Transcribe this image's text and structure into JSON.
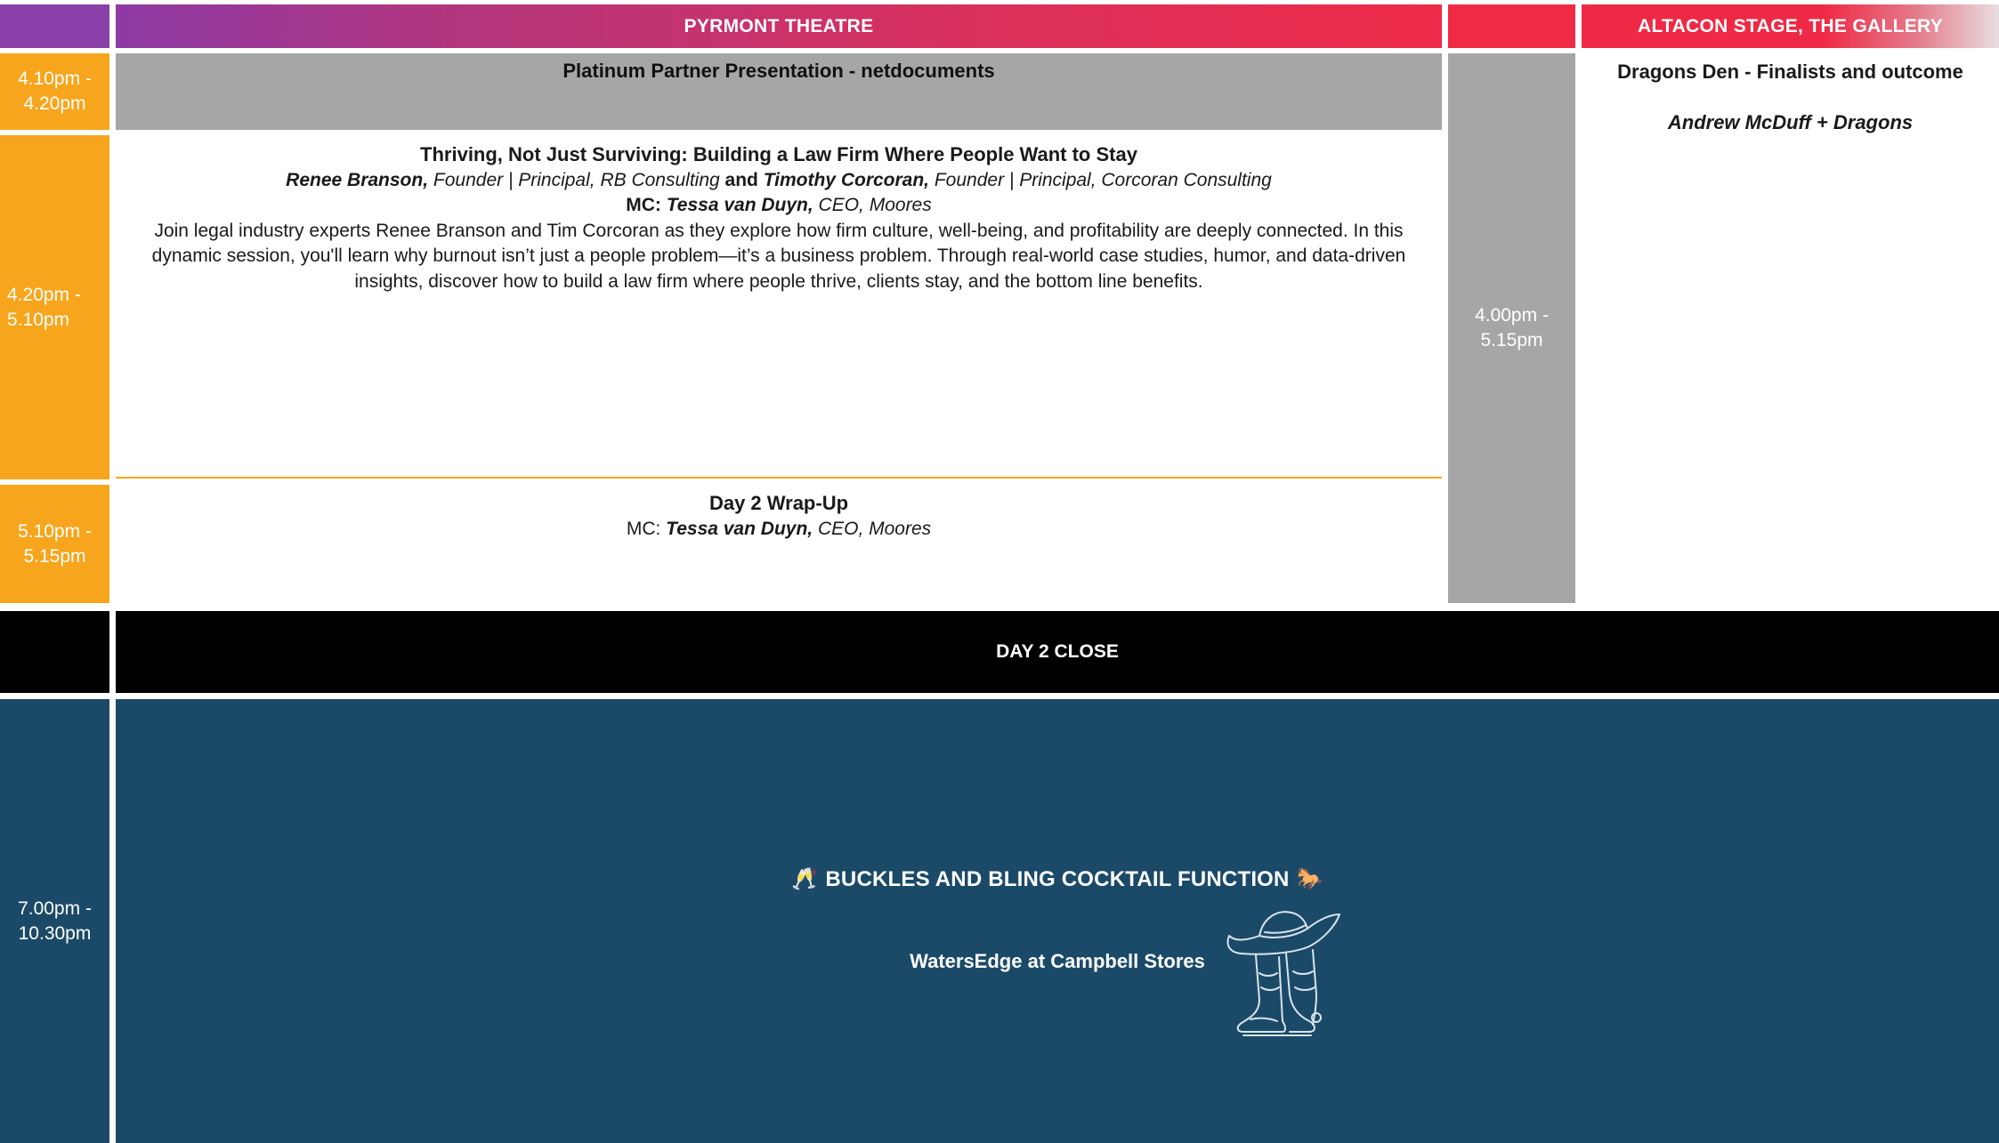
{
  "header": {
    "main_title": "PYRMONT THEATRE",
    "alt_title": "ALTACON STAGE, THE GALLERY"
  },
  "times": {
    "platinum": [
      "4.10pm -",
      "4.20pm"
    ],
    "thriving": [
      "4.20pm -",
      "5.10pm"
    ],
    "wrap": [
      "5.10pm -",
      "5.15pm"
    ],
    "gallery": [
      "4.00pm -",
      "5.15pm"
    ],
    "cocktail": [
      "7.00pm -",
      "10.30pm"
    ]
  },
  "platinum": {
    "title": "Platinum Partner Presentation - netdocuments"
  },
  "thriving": {
    "title": "Thriving, Not Just Surviving: Building a Law Firm Where People Want to Stay",
    "speaker1_name": "Renee Branson,",
    "speaker1_role": " Founder | Principal, RB Consulting",
    "and": " and ",
    "speaker2_name": "Timothy Corcoran,",
    "speaker2_role": " Founder | Principal, Corcoran Consulting",
    "mc_label": "MC: ",
    "mc_name": "Tessa van Duyn,",
    "mc_role": " CEO, Moores",
    "description": "Join legal industry experts Renee Branson and Tim Corcoran as they explore how firm culture, well-being, and profitability are deeply connected. In this dynamic session, you'll learn why burnout isn’t just a people problem—it’s a business problem. Through real-world case studies, humor, and data-driven insights, discover how to build a law firm where people thrive, clients stay, and the bottom line benefits."
  },
  "wrap": {
    "title": "Day 2 Wrap-Up",
    "mc_label": "MC: ",
    "mc_name": "Tessa van Duyn,",
    "mc_role": " CEO, Moores"
  },
  "altacon": {
    "title": "Dragons Den - Finalists and outcome",
    "speaker": "Andrew McDuff + Dragons"
  },
  "close": {
    "title": "DAY 2 CLOSE"
  },
  "cocktail": {
    "emoji_left": "🥂",
    "title": "BUCKLES AND BLING COCKTAIL FUNCTION",
    "emoji_right": "🐎",
    "venue": "WatersEdge at Campbell Stores",
    "illustration_icon": "cowboy-hat-and-boots-icon"
  },
  "colors": {
    "time_orange": "#f7a51c",
    "session_gray": "#a6a6a6",
    "navy": "#1b4a68",
    "header_purple": "#8e3aa5",
    "header_red": "#ee2b49",
    "black": "#000000"
  }
}
